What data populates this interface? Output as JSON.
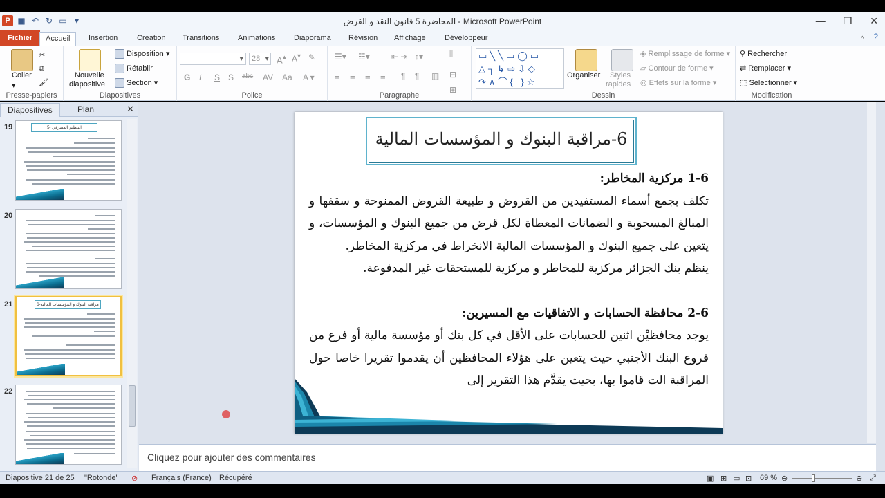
{
  "window": {
    "title": "المحاضرة 5 قانون النقد و القرض  -  Microsoft PowerPoint",
    "min": "—",
    "max": "❐",
    "close": "✕"
  },
  "tabs": [
    "Fichier",
    "Accueil",
    "Insertion",
    "Création",
    "Transitions",
    "Animations",
    "Diaporama",
    "Révision",
    "Affichage",
    "Développeur"
  ],
  "ribbon": {
    "presse_papiers": {
      "coller": "Coller",
      "label": "Presse-papiers"
    },
    "diapositives": {
      "nouvelle": "Nouvelle",
      "diapositive": "diapositive",
      "disposition": "Disposition",
      "retablir": "Rétablir",
      "section": "Section",
      "label": "Diapositives"
    },
    "police": {
      "size": "28",
      "label": "Police",
      "bold": "G",
      "italic": "I",
      "underline": "S",
      "strike": "abc",
      "shadow": "S"
    },
    "paragraphe": {
      "label": "Paragraphe"
    },
    "dessin": {
      "organiser": "Organiser",
      "styles": "Styles",
      "rapides": "rapides",
      "remplissage": "Remplissage de forme",
      "contour": "Contour de forme",
      "effets": "Effets sur la forme",
      "label": "Dessin"
    },
    "modification": {
      "rechercher": "Rechercher",
      "remplacer": "Remplacer",
      "selectionner": "Sélectionner",
      "label": "Modification"
    }
  },
  "panel": {
    "tab_slides": "Diapositives",
    "tab_plan": "Plan"
  },
  "thumbnails": [
    {
      "num": "19",
      "title": "5- التنظيم المصرفي"
    },
    {
      "num": "20",
      "title": ""
    },
    {
      "num": "21",
      "title": "6-مراقبة البنوك و المؤسسات المالية"
    },
    {
      "num": "22",
      "title": ""
    }
  ],
  "slide": {
    "title": "6-مراقبة البنوك و المؤسسات المالية",
    "h1": "1-6 مركزية المخاطر:",
    "p1": "تكلف بجمع أسماء المستفيدين من القروض و طبيعة القروض الممنوحة و سقفها و المبالغ المسحوبة و الضمانات المعطاة لكل قرض من جميع البنوك و المؤسسات، و يتعين على جميع البنوك و المؤسسات المالية الانخراط في مركزية المخاطر.",
    "p2": "ينظم بنك الجزائر مركزية للمخاطر و مركزية للمستحقات غير المدفوعة.",
    "h2": "2-6 محافظة الحسابات و الاتفاقيات مع المسيرين:",
    "p3": "يوجد محافظيْن اثنين للحسابات على الأقل في كل بنك أو مؤسسة مالية أو فرع من فروع البنك الأجنبي حيث يتعين على هؤلاء المحافظين أن يقدموا تقريرا خاصا حول المراقبة الت قاموا بها، بحيث يقدَّم هذا التقرير إلى"
  },
  "comments_placeholder": "Cliquez pour ajouter des commentaires",
  "status": {
    "slide": "Diapositive 21 de 25",
    "theme": "\"Rotonde\"",
    "lang": "Français (France)",
    "state": "Récupéré",
    "zoom": "69 %"
  }
}
